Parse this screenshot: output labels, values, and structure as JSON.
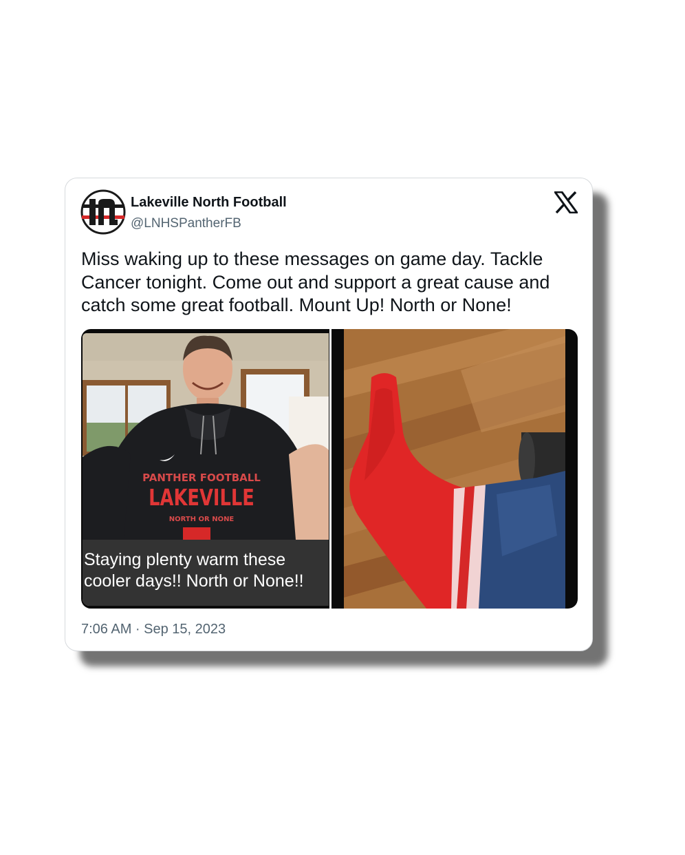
{
  "tweet": {
    "display_name": "Lakeville North Football",
    "handle": "@LNHSPantherFB",
    "text": "Miss waking up to these messages on game day. Tackle Cancer tonight. Come out and support a great cause and catch some great football. Mount Up! North or None!",
    "timestamp": "7:06 AM · Sep 15, 2023",
    "avatar_icon": "lakeville-north-ln-logo",
    "platform_icon": "x-logo-icon"
  },
  "media": {
    "left_photo": {
      "description_icon": "selfie-photo",
      "hoodie_lines": [
        "PANTHER FOOTBALL",
        "LAKEVILLE",
        "NORTH OR NONE"
      ],
      "caption": "Staying plenty warm these cooler days!!  North or None!!"
    },
    "right_photo": {
      "description_icon": "red-sock-photo"
    }
  },
  "colors": {
    "text_primary": "#0f1419",
    "text_secondary": "#536471",
    "brand_red": "#d62828",
    "caption_bg": "#333333"
  }
}
